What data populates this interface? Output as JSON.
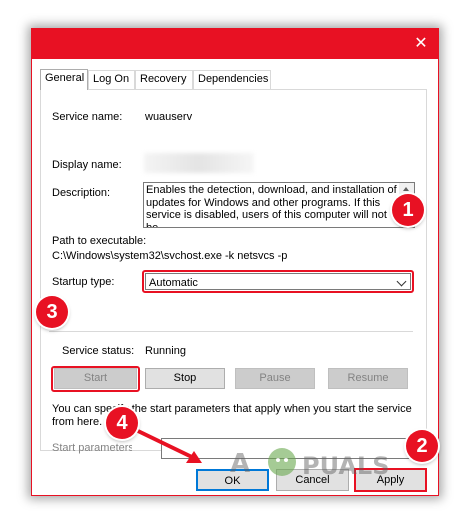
{
  "window": {
    "close_glyph": "✕"
  },
  "tabs": [
    {
      "label": "General",
      "active": true
    },
    {
      "label": "Log On",
      "active": false
    },
    {
      "label": "Recovery",
      "active": false
    },
    {
      "label": "Dependencies",
      "active": false
    }
  ],
  "general": {
    "service_name_label": "Service name:",
    "service_name_value": "wuauserv",
    "display_name_label": "Display name:",
    "description_label": "Description:",
    "description_text": "Enables the detection, download, and installation of updates for Windows and other programs. If this service is disabled, users of this computer will not be",
    "path_label": "Path to executable:",
    "path_value": "C:\\Windows\\system32\\svchost.exe -k netsvcs -p",
    "startup_type_label": "Startup type:",
    "startup_type_value": "Automatic",
    "service_status_label": "Service status:",
    "service_status_value": "Running",
    "params_hint": "You can specify the start parameters that apply when you start the service from here.",
    "start_params_label": "Start parameters:"
  },
  "service_buttons": {
    "start": "Start",
    "stop": "Stop",
    "pause": "Pause",
    "resume": "Resume"
  },
  "footer": {
    "ok": "OK",
    "cancel": "Cancel",
    "apply": "Apply"
  },
  "annotations": {
    "step1": "1",
    "step2": "2",
    "step3": "3",
    "step4": "4"
  },
  "colors": {
    "accent_red": "#e81123",
    "focus_blue": "#0078d7"
  }
}
